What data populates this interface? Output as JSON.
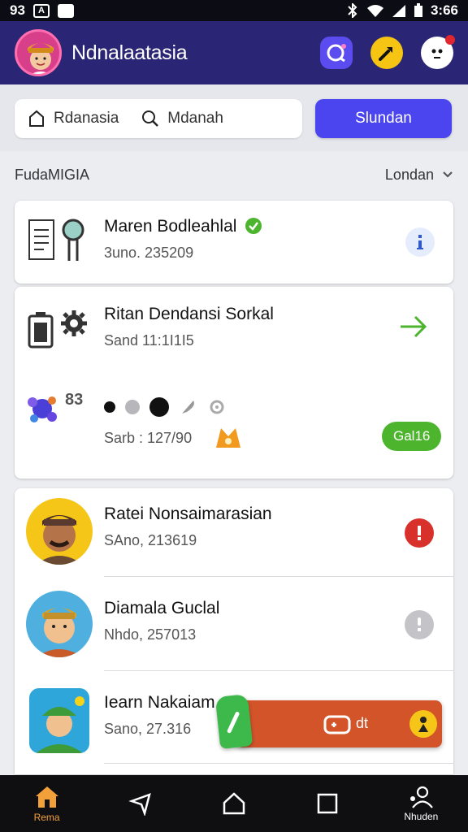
{
  "status_bar": {
    "left_text": "93",
    "time": "3:66"
  },
  "app_bar": {
    "title": "Ndnalaatasia",
    "icons": [
      "chat-icon",
      "tool-icon",
      "alert-icon"
    ]
  },
  "search": {
    "seg1_label": "Rdanasia",
    "seg2_label": "Mdanah",
    "button_label": "Slundan"
  },
  "filter": {
    "left_label": "FudaMIGIA",
    "sort_label": "Londan"
  },
  "cards": {
    "card1": {
      "title": "Maren Bodleahlal",
      "sub": "3uno. 235209"
    },
    "card2": {
      "title": "Ritan Dendansi Sorkal",
      "sub": "Sand 11:1I1I5",
      "counter": "83",
      "sub2": "Sarb : 127/90",
      "pill": "Gal16"
    },
    "list": [
      {
        "title": "Ratei Nonsaimarasian",
        "sub": "SAno, 213619"
      },
      {
        "title": "Diamala Guclal",
        "sub": "Nhdo, 257013"
      },
      {
        "title": "Iearn Nakaiam",
        "sub": "Sano, 27.316"
      }
    ]
  },
  "floating": {
    "label": "dt"
  },
  "bottom_nav": {
    "home_label": "Rema",
    "profile_label": "Nhuden"
  },
  "colors": {
    "app_bar": "#2a2675",
    "primary_button": "#4a45ef",
    "accent_green": "#4cb52d",
    "alert_red": "#e0262e",
    "float_bar": "#d4542a"
  }
}
